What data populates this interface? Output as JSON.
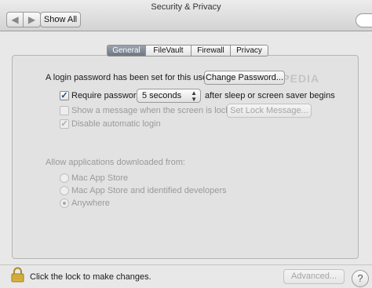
{
  "window": {
    "title": "Security & Privacy"
  },
  "toolbar": {
    "back_glyph": "◀",
    "forward_glyph": "▶",
    "show_all_label": "Show All"
  },
  "tabs": [
    {
      "label": "General",
      "active": true
    },
    {
      "label": "FileVault",
      "active": false
    },
    {
      "label": "Firewall",
      "active": false
    },
    {
      "label": "Privacy",
      "active": false
    }
  ],
  "general": {
    "login_password_text": "A login password has been set for this user",
    "change_password_label": "Change Password...",
    "require_password": {
      "checked": true,
      "label": "Require password",
      "delay_value": "5 seconds",
      "suffix": "after sleep or screen saver begins"
    },
    "show_message": {
      "checked": false,
      "enabled": false,
      "label": "Show a message when the screen is locked",
      "button_label": "Set Lock Message..."
    },
    "disable_auto_login": {
      "checked": true,
      "enabled": false,
      "label": "Disable automatic login"
    }
  },
  "allow_apps": {
    "heading": "Allow applications downloaded from:",
    "options": [
      {
        "label": "Mac App Store",
        "selected": false
      },
      {
        "label": "Mac App Store and identified developers",
        "selected": false
      },
      {
        "label": "Anywhere",
        "selected": true
      }
    ]
  },
  "footer": {
    "lock_text": "Click the lock to make changes.",
    "advanced_label": "Advanced...",
    "help_glyph": "?"
  },
  "watermark": {
    "text": "SOFTPEDIA"
  },
  "icons": {
    "lock": "lock-icon",
    "help": "help-icon",
    "check": "checkmark-icon",
    "select_arrows": "updown-arrows-icon"
  },
  "colors": {
    "selected_tab": "#7a838e",
    "checkmark": "#1c3f8a",
    "window_bg": "#e8e8e8"
  }
}
